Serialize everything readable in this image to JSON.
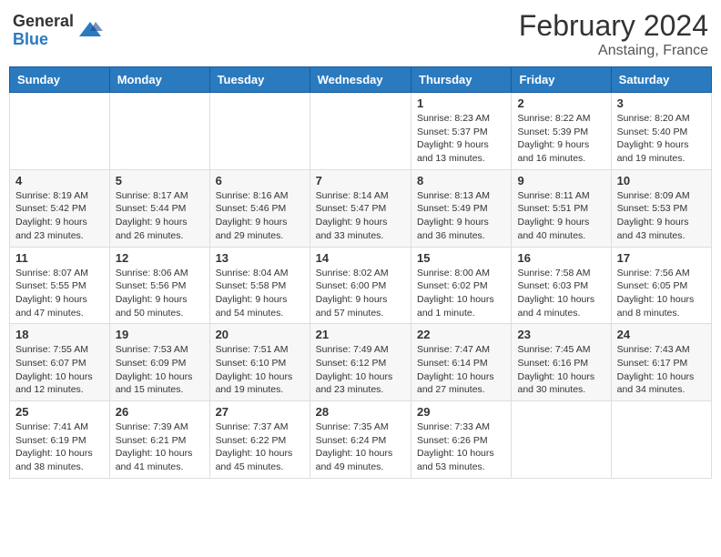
{
  "logo": {
    "general": "General",
    "blue": "Blue"
  },
  "title": {
    "month_year": "February 2024",
    "location": "Anstaing, France"
  },
  "headers": [
    "Sunday",
    "Monday",
    "Tuesday",
    "Wednesday",
    "Thursday",
    "Friday",
    "Saturday"
  ],
  "weeks": [
    [
      {
        "day": "",
        "info": ""
      },
      {
        "day": "",
        "info": ""
      },
      {
        "day": "",
        "info": ""
      },
      {
        "day": "",
        "info": ""
      },
      {
        "day": "1",
        "info": "Sunrise: 8:23 AM\nSunset: 5:37 PM\nDaylight: 9 hours\nand 13 minutes."
      },
      {
        "day": "2",
        "info": "Sunrise: 8:22 AM\nSunset: 5:39 PM\nDaylight: 9 hours\nand 16 minutes."
      },
      {
        "day": "3",
        "info": "Sunrise: 8:20 AM\nSunset: 5:40 PM\nDaylight: 9 hours\nand 19 minutes."
      }
    ],
    [
      {
        "day": "4",
        "info": "Sunrise: 8:19 AM\nSunset: 5:42 PM\nDaylight: 9 hours\nand 23 minutes."
      },
      {
        "day": "5",
        "info": "Sunrise: 8:17 AM\nSunset: 5:44 PM\nDaylight: 9 hours\nand 26 minutes."
      },
      {
        "day": "6",
        "info": "Sunrise: 8:16 AM\nSunset: 5:46 PM\nDaylight: 9 hours\nand 29 minutes."
      },
      {
        "day": "7",
        "info": "Sunrise: 8:14 AM\nSunset: 5:47 PM\nDaylight: 9 hours\nand 33 minutes."
      },
      {
        "day": "8",
        "info": "Sunrise: 8:13 AM\nSunset: 5:49 PM\nDaylight: 9 hours\nand 36 minutes."
      },
      {
        "day": "9",
        "info": "Sunrise: 8:11 AM\nSunset: 5:51 PM\nDaylight: 9 hours\nand 40 minutes."
      },
      {
        "day": "10",
        "info": "Sunrise: 8:09 AM\nSunset: 5:53 PM\nDaylight: 9 hours\nand 43 minutes."
      }
    ],
    [
      {
        "day": "11",
        "info": "Sunrise: 8:07 AM\nSunset: 5:55 PM\nDaylight: 9 hours\nand 47 minutes."
      },
      {
        "day": "12",
        "info": "Sunrise: 8:06 AM\nSunset: 5:56 PM\nDaylight: 9 hours\nand 50 minutes."
      },
      {
        "day": "13",
        "info": "Sunrise: 8:04 AM\nSunset: 5:58 PM\nDaylight: 9 hours\nand 54 minutes."
      },
      {
        "day": "14",
        "info": "Sunrise: 8:02 AM\nSunset: 6:00 PM\nDaylight: 9 hours\nand 57 minutes."
      },
      {
        "day": "15",
        "info": "Sunrise: 8:00 AM\nSunset: 6:02 PM\nDaylight: 10 hours\nand 1 minute."
      },
      {
        "day": "16",
        "info": "Sunrise: 7:58 AM\nSunset: 6:03 PM\nDaylight: 10 hours\nand 4 minutes."
      },
      {
        "day": "17",
        "info": "Sunrise: 7:56 AM\nSunset: 6:05 PM\nDaylight: 10 hours\nand 8 minutes."
      }
    ],
    [
      {
        "day": "18",
        "info": "Sunrise: 7:55 AM\nSunset: 6:07 PM\nDaylight: 10 hours\nand 12 minutes."
      },
      {
        "day": "19",
        "info": "Sunrise: 7:53 AM\nSunset: 6:09 PM\nDaylight: 10 hours\nand 15 minutes."
      },
      {
        "day": "20",
        "info": "Sunrise: 7:51 AM\nSunset: 6:10 PM\nDaylight: 10 hours\nand 19 minutes."
      },
      {
        "day": "21",
        "info": "Sunrise: 7:49 AM\nSunset: 6:12 PM\nDaylight: 10 hours\nand 23 minutes."
      },
      {
        "day": "22",
        "info": "Sunrise: 7:47 AM\nSunset: 6:14 PM\nDaylight: 10 hours\nand 27 minutes."
      },
      {
        "day": "23",
        "info": "Sunrise: 7:45 AM\nSunset: 6:16 PM\nDaylight: 10 hours\nand 30 minutes."
      },
      {
        "day": "24",
        "info": "Sunrise: 7:43 AM\nSunset: 6:17 PM\nDaylight: 10 hours\nand 34 minutes."
      }
    ],
    [
      {
        "day": "25",
        "info": "Sunrise: 7:41 AM\nSunset: 6:19 PM\nDaylight: 10 hours\nand 38 minutes."
      },
      {
        "day": "26",
        "info": "Sunrise: 7:39 AM\nSunset: 6:21 PM\nDaylight: 10 hours\nand 41 minutes."
      },
      {
        "day": "27",
        "info": "Sunrise: 7:37 AM\nSunset: 6:22 PM\nDaylight: 10 hours\nand 45 minutes."
      },
      {
        "day": "28",
        "info": "Sunrise: 7:35 AM\nSunset: 6:24 PM\nDaylight: 10 hours\nand 49 minutes."
      },
      {
        "day": "29",
        "info": "Sunrise: 7:33 AM\nSunset: 6:26 PM\nDaylight: 10 hours\nand 53 minutes."
      },
      {
        "day": "",
        "info": ""
      },
      {
        "day": "",
        "info": ""
      }
    ]
  ]
}
